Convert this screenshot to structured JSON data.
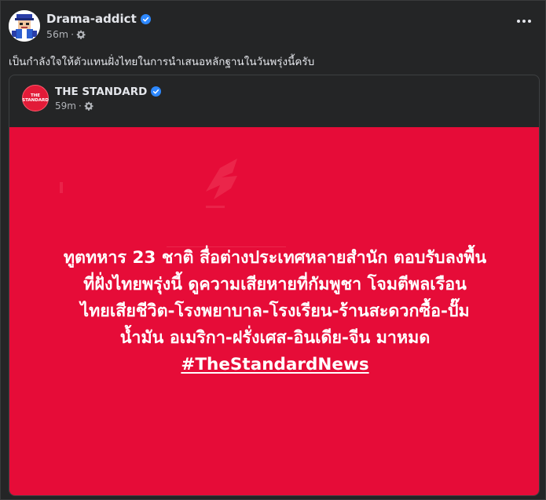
{
  "post": {
    "author": "Drama-addict",
    "time": "56m",
    "caption": "เป็นกำลังใจให้ตัวแทนฝั่งไทยในการนำเสนอหลักฐานในวันพรุ่งนี้ครับ",
    "menu_icon": "more-horizontal-icon",
    "audience_icon": "gear-icon",
    "verified_icon": "verified-badge-icon"
  },
  "shared": {
    "page_name": "THE STANDARD",
    "time": "59m",
    "logo_text": "THE STANDARD",
    "headline_lines": [
      "ทูตทหาร 23 ชาติ สื่อต่างประเทศหลายสำนัก ตอบรับลงพื้น",
      "ที่ฝั่งไทยพรุ่งนี้ ดูความเสียหายที่กัมพูชา โจมตีพลเรือน",
      "ไทยเสียชีวิต-โรงพยาบาล-โรงเรียน-ร้านสะดวกซื้อ-ปั๊ม",
      "น้ำมัน อเมริกา-ฝรั่งเศส-อินเดีย-จีน มาหมด"
    ],
    "hashtag": "#TheStandardNews"
  },
  "colors": {
    "background": "#242526",
    "image_red": "#e60c38",
    "verified_blue": "#2d88ff",
    "text_primary": "#e4e6eb",
    "text_secondary": "#b0b3b8"
  }
}
